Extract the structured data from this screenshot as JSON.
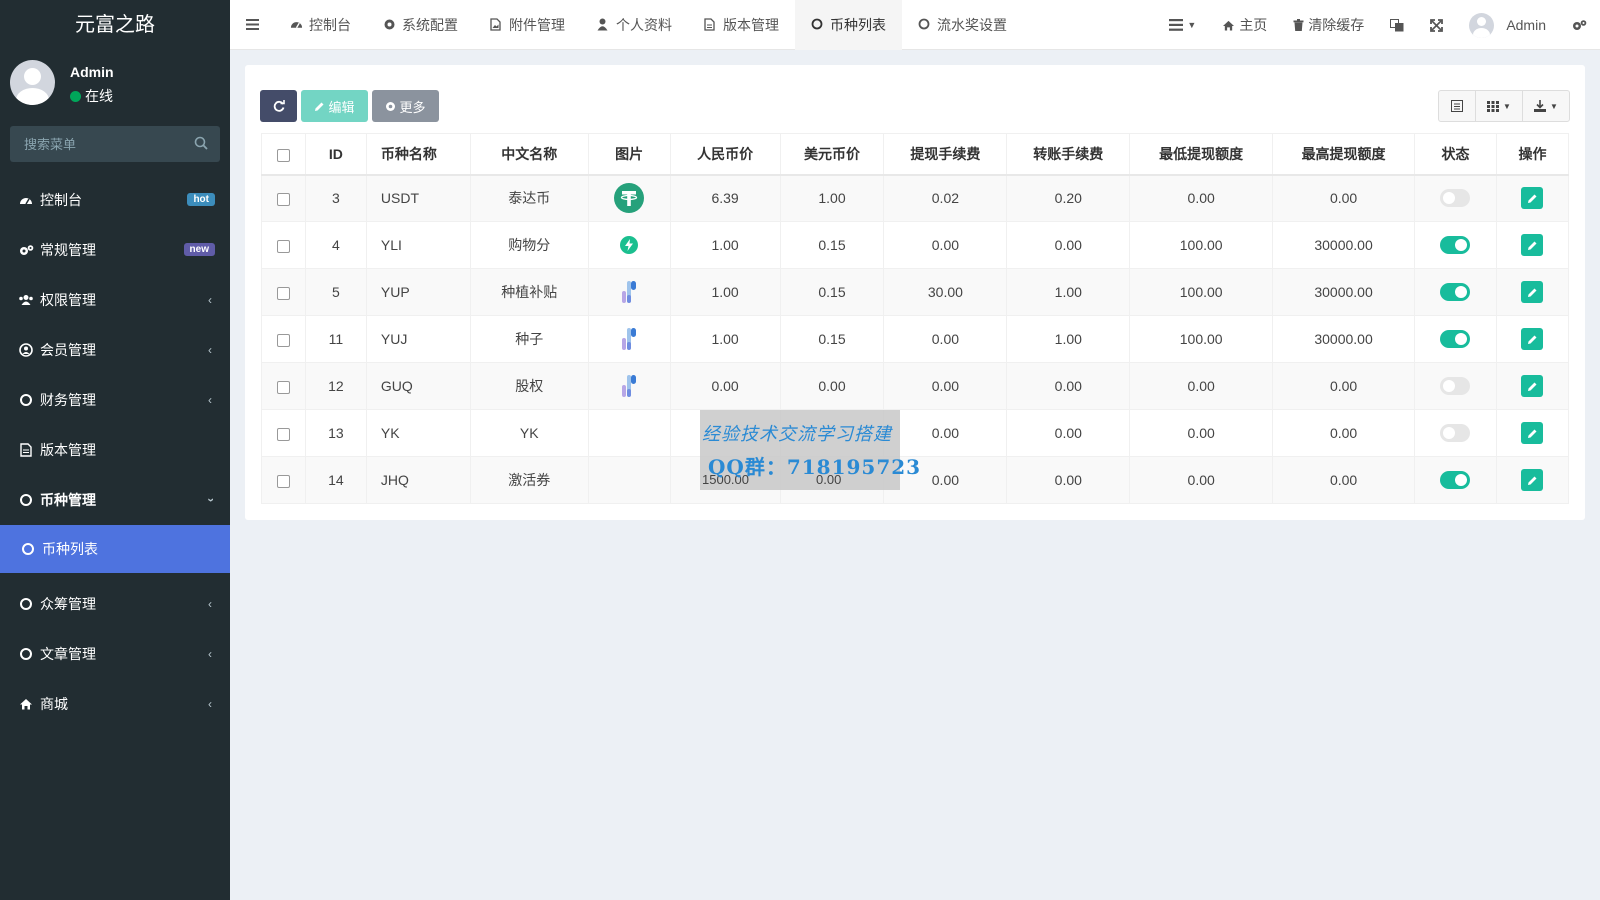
{
  "app": {
    "logo": "元富之路"
  },
  "user": {
    "name": "Admin",
    "status": "在线"
  },
  "sidebar": {
    "search_placeholder": "搜索菜单",
    "items": [
      {
        "label": "控制台",
        "icon": "dashboard-icon",
        "badge": "hot"
      },
      {
        "label": "常规管理",
        "icon": "gears-icon",
        "badge": "new"
      },
      {
        "label": "权限管理",
        "icon": "group-icon"
      },
      {
        "label": "会员管理",
        "icon": "user-circle-icon"
      },
      {
        "label": "财务管理",
        "icon": "circle-icon"
      },
      {
        "label": "版本管理",
        "icon": "file-icon"
      },
      {
        "label": "币种管理",
        "icon": "circle-icon",
        "expanded": true
      },
      {
        "label": "币种列表",
        "icon": "circle-icon",
        "active": true
      },
      {
        "label": "众筹管理",
        "icon": "circle-icon"
      },
      {
        "label": "文章管理",
        "icon": "circle-icon"
      },
      {
        "label": "商城",
        "icon": "home-icon"
      }
    ]
  },
  "topnav": {
    "tabs": [
      "控制台",
      "系统配置",
      "附件管理",
      "个人资料",
      "版本管理",
      "币种列表",
      "流水奖设置"
    ],
    "active_tab": "币种列表",
    "right": {
      "home": "主页",
      "clear_cache": "清除缓存",
      "admin": "Admin"
    }
  },
  "toolbar": {
    "edit": "编辑",
    "more": "更多"
  },
  "table": {
    "headers": [
      "ID",
      "币种名称",
      "中文名称",
      "图片",
      "人民币价",
      "美元币价",
      "提现手续费",
      "转账手续费",
      "最低提现额度",
      "最高提现额度",
      "状态",
      "操作"
    ],
    "rows": [
      {
        "id": "3",
        "name": "USDT",
        "cn": "泰达币",
        "img": "tether",
        "cny": "6.39",
        "usd": "1.00",
        "wfee": "0.02",
        "tfee": "0.20",
        "min": "0.00",
        "max": "0.00",
        "status": false
      },
      {
        "id": "4",
        "name": "YLI",
        "cn": "购物分",
        "img": "bolt",
        "cny": "1.00",
        "usd": "0.15",
        "wfee": "0.00",
        "tfee": "0.00",
        "min": "100.00",
        "max": "30000.00",
        "status": true
      },
      {
        "id": "5",
        "name": "YUP",
        "cn": "种植补贴",
        "img": "logo",
        "cny": "1.00",
        "usd": "0.15",
        "wfee": "30.00",
        "tfee": "1.00",
        "min": "100.00",
        "max": "30000.00",
        "status": true
      },
      {
        "id": "11",
        "name": "YUJ",
        "cn": "种子",
        "img": "logo",
        "cny": "1.00",
        "usd": "0.15",
        "wfee": "0.00",
        "tfee": "1.00",
        "min": "100.00",
        "max": "30000.00",
        "status": true
      },
      {
        "id": "12",
        "name": "GUQ",
        "cn": "股权",
        "img": "logo",
        "cny": "0.00",
        "usd": "0.00",
        "wfee": "0.00",
        "tfee": "0.00",
        "min": "0.00",
        "max": "0.00",
        "status": false
      },
      {
        "id": "13",
        "name": "YK",
        "cn": "YK",
        "img": "",
        "cny": "",
        "usd": "",
        "wfee": "0.00",
        "tfee": "0.00",
        "min": "0.00",
        "max": "0.00",
        "status": false
      },
      {
        "id": "14",
        "name": "JHQ",
        "cn": "激活券",
        "img": "",
        "cny": "",
        "usd": "",
        "wfee": "0.00",
        "tfee": "0.00",
        "min": "0.00",
        "max": "0.00",
        "status": true
      }
    ]
  },
  "watermark": {
    "line1": "经验技术交流学习搭建",
    "line2": "QQ群：718195723",
    "row7_cny": "1500.00",
    "row7_usd": "0.00"
  },
  "colors": {
    "accent": "#18bc9c",
    "sidebar": "#222d32",
    "active_menu": "#4e73df"
  }
}
